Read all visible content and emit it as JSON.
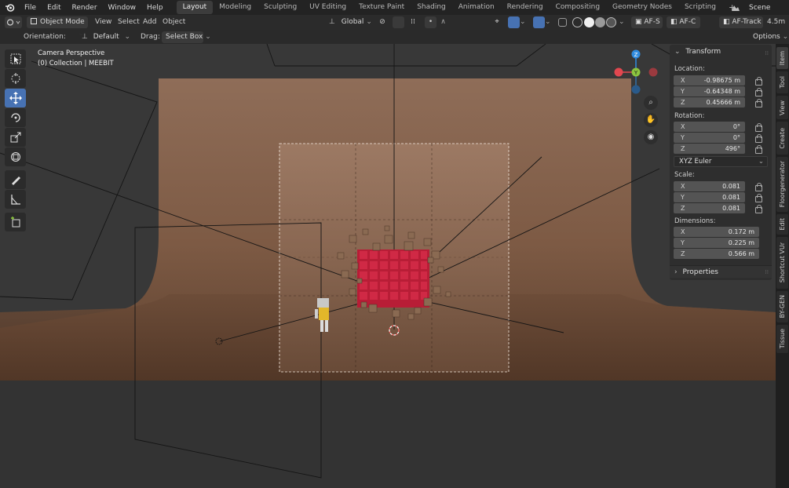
{
  "menubar": {
    "items": [
      "File",
      "Edit",
      "Render",
      "Window",
      "Help"
    ],
    "workspaces": [
      "Layout",
      "Modeling",
      "Sculpting",
      "UV Editing",
      "Texture Paint",
      "Shading",
      "Animation",
      "Rendering",
      "Compositing",
      "Geometry Nodes",
      "Scripting"
    ],
    "active_workspace": "Layout",
    "add_tab": "+",
    "scene_label": "Scene"
  },
  "header": {
    "mode": "Object Mode",
    "menus": [
      "View",
      "Select",
      "Add",
      "Object"
    ],
    "transform_orientation": "Global",
    "af_s": "AF-S",
    "af_c": "AF-C",
    "af_track": "AF-Track",
    "distance": "4.5m"
  },
  "tool_settings": {
    "orientation_label": "Orientation:",
    "orientation_value": "Default",
    "drag_label": "Drag:",
    "drag_value": "Select Box",
    "options_label": "Options"
  },
  "viewport": {
    "view_name": "Camera Perspective",
    "collection_info": "(0) Collection | MEEBIT",
    "colors": {
      "gizmo_x": "#e2474f",
      "gizmo_y": "#8bc43f",
      "gizmo_z": "#2f8be0",
      "cube_red": "#c0223c",
      "bg_tan": "#8a6a55"
    }
  },
  "tools": [
    "select-box-icon",
    "cursor-icon",
    "move-icon",
    "rotate-icon",
    "scale-icon",
    "transform-icon",
    "annotate-icon",
    "measure-icon",
    "add-cube-icon"
  ],
  "transform_panel": {
    "title": "Transform",
    "location_label": "Location:",
    "location": [
      {
        "axis": "X",
        "value": "-0.98675 m"
      },
      {
        "axis": "Y",
        "value": "-0.64348 m"
      },
      {
        "axis": "Z",
        "value": "0.45666 m"
      }
    ],
    "rotation_label": "Rotation:",
    "rotation": [
      {
        "axis": "X",
        "value": "0°"
      },
      {
        "axis": "Y",
        "value": "0°"
      },
      {
        "axis": "Z",
        "value": "496°"
      }
    ],
    "rotation_mode": "XYZ Euler",
    "scale_label": "Scale:",
    "scale": [
      {
        "axis": "X",
        "value": "0.081"
      },
      {
        "axis": "Y",
        "value": "0.081"
      },
      {
        "axis": "Z",
        "value": "0.081"
      }
    ],
    "dimensions_label": "Dimensions:",
    "dimensions": [
      {
        "axis": "X",
        "value": "0.172 m"
      },
      {
        "axis": "Y",
        "value": "0.225 m"
      },
      {
        "axis": "Z",
        "value": "0.566 m"
      }
    ],
    "properties_label": "Properties"
  },
  "side_tabs": [
    "Item",
    "Tool",
    "View",
    "Create",
    "Floorgenerator",
    "Edit",
    "Shortcut VUr",
    "BY-GEN",
    "Tissue"
  ]
}
